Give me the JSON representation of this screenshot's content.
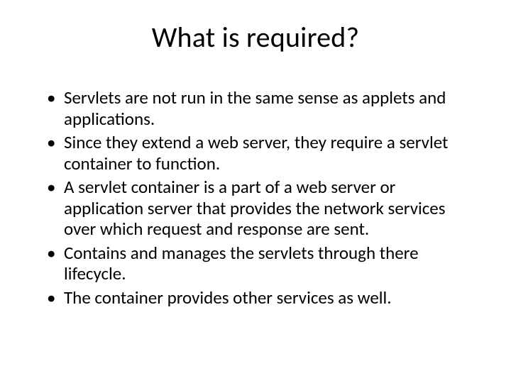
{
  "slide": {
    "title": "What is required?",
    "bullets": [
      "Servlets are not run in the same sense as applets and applications.",
      "Since they extend a web server, they require a servlet container to function.",
      "A servlet container is a part of a web server or application server that provides the network services over which request and response are sent.",
      "Contains and manages the servlets through there lifecycle.",
      "The container provides other services as well."
    ]
  }
}
